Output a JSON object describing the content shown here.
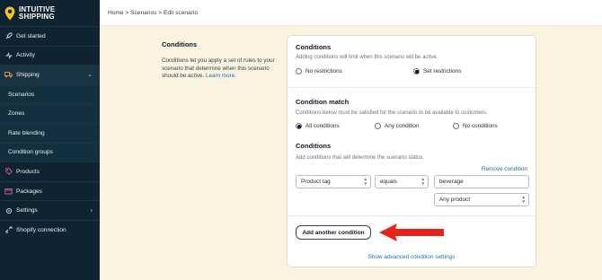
{
  "brand": {
    "line1": "INTUITIVE",
    "line2": "SHIPPING"
  },
  "nav": {
    "items": [
      {
        "label": "Get started",
        "icon": "rocket-icon"
      },
      {
        "label": "Activity",
        "icon": "activity-icon"
      },
      {
        "label": "Shipping",
        "icon": "truck-icon"
      },
      {
        "label": "Scenarios"
      },
      {
        "label": "Zones"
      },
      {
        "label": "Rate blending"
      },
      {
        "label": "Condition groups"
      },
      {
        "label": "Products",
        "icon": "tag-icon"
      },
      {
        "label": "Packages",
        "icon": "package-icon"
      },
      {
        "label": "Settings",
        "icon": "gear-icon"
      },
      {
        "label": "Shopify connection",
        "icon": "link-icon"
      }
    ]
  },
  "breadcrumb": "Home > Scenarios > Edit scenario",
  "desc": {
    "title": "Conditions",
    "body": "Conditions let you apply a set of rules to your scenario that determine when this scenario should be active.",
    "link": "Learn more."
  },
  "card": {
    "conditions": {
      "title": "Conditions",
      "subtitle": "Adding conditions will limit when this scenario will be active.",
      "opt_none": "No restrictions",
      "opt_set": "Set restrictions"
    },
    "match": {
      "title": "Condition match",
      "subtitle": "Conditions below must be satisfied for the scenario to be available to customers.",
      "opt_all": "All conditions",
      "opt_any": "Any condition",
      "opt_no": "No conditions"
    },
    "rules": {
      "title": "Conditions",
      "subtitle": "Add conditions that will determine the scenario status.",
      "remove": "Remove condition",
      "field": "Product tag",
      "operator": "equals",
      "value": "beverage",
      "scope": "Any product"
    },
    "add_button": "Add another condition",
    "advanced_link": "Show advanced condition settings"
  },
  "colors": {
    "arrow": "#e8221b",
    "sidebar": "#0f2430",
    "link": "#1d6fa5"
  }
}
